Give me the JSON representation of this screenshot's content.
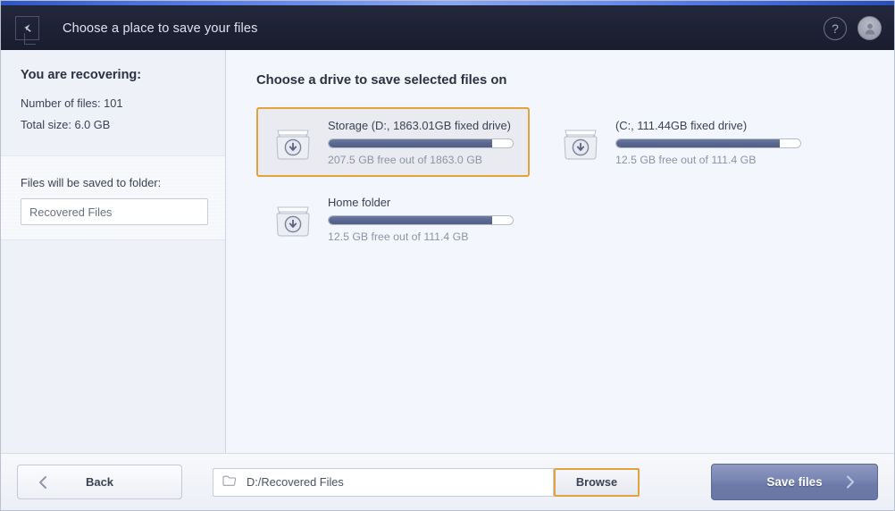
{
  "header": {
    "title": "Choose a place to save your files",
    "back_icon": "back-arrow-icon",
    "help_label": "?",
    "help_icon": "help-icon",
    "avatar_icon": "user-avatar-icon"
  },
  "sidebar": {
    "title": "You are recovering:",
    "stats": [
      "Number of files: 101",
      "Total size: 6.0 GB"
    ],
    "folder_label": "Files will be saved to folder:",
    "folder_value": "Recovered Files",
    "folder_placeholder": "Recovered Files"
  },
  "main": {
    "title": "Choose a drive to save selected files on",
    "drives": [
      {
        "name": "Storage (D:, 1863.01GB fixed drive)",
        "sub": "207.5 GB free out of 1863.0 GB",
        "used_percent": 89,
        "selected": true,
        "icon": "drive-box-download-icon"
      },
      {
        "name": "(C:, 111.44GB fixed drive)",
        "sub": "12.5 GB free out of 111.4 GB",
        "used_percent": 89,
        "selected": false,
        "icon": "drive-box-download-icon"
      },
      {
        "name": "Home folder",
        "sub": "12.5 GB free out of 111.4 GB",
        "used_percent": 89,
        "selected": false,
        "icon": "drive-box-download-icon"
      }
    ]
  },
  "footer": {
    "back_label": "Back",
    "back_icon": "chevron-left-icon",
    "path_value": "D:/Recovered Files",
    "path_icon": "folder-icon",
    "browse_label": "Browse",
    "save_label": "Save files",
    "save_icon": "chevron-right-icon"
  },
  "colors": {
    "accent_orange": "#e3a23c",
    "header_bg": "#1d2134",
    "strip_blue": "#6a8cea",
    "bar_fill": "#5b6991",
    "save_btn": "#7a86b3"
  }
}
